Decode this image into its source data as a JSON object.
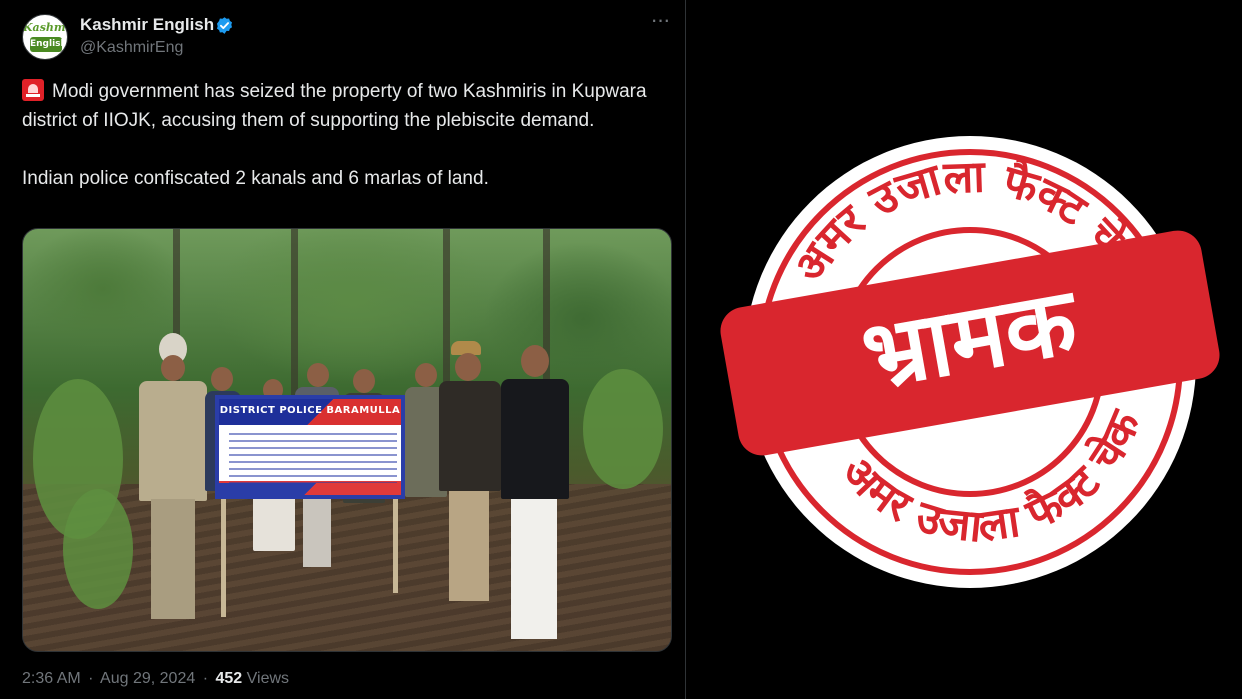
{
  "tweet": {
    "avatar_top": "Kashmir",
    "avatar_bottom": "English",
    "display_name": "Kashmir English",
    "handle": "@KashmirEng",
    "more_icon": "more-horizontal-icon",
    "verified_icon": "verified-badge-icon",
    "body_emoji_icon": "police-siren-icon",
    "body_line1": "Modi government has seized the property of two Kashmiris in Kupwara district of IIOJK, accusing them of supporting the plebiscite demand.",
    "body_line2": "Indian police confiscated 2 kanals and 6 marlas of land.",
    "photo": {
      "sign_title": "DISTRICT POLICE BARAMULLA"
    },
    "time": "2:36 AM",
    "date": "Aug 29, 2024",
    "separator": "·",
    "views_count": "452",
    "views_label": "Views"
  },
  "stamp": {
    "ring_text_top": "अमर उजाला फैक्ट चेक",
    "ring_text_bottom": "अमर उजाला फैक्ट चेक",
    "verdict": "भ्रामक",
    "colors": {
      "red": "#d9262e",
      "ring_fill": "#ffffff"
    }
  },
  "colors": {
    "background": "#000000",
    "text_primary": "#e7e9ea",
    "text_secondary": "#71767b",
    "verified_blue": "#1d9bf0"
  }
}
